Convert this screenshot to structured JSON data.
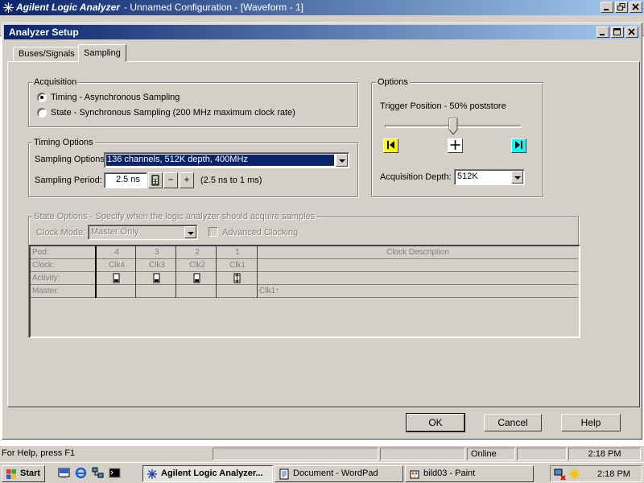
{
  "app": {
    "title_bold": "Agilent Logic Analyzer",
    "title_rest": "- Unnamed Configuration - [Waveform - 1]"
  },
  "dialog": {
    "title": "Analyzer Setup",
    "tabs": [
      {
        "label": "Buses/Signals",
        "active": false
      },
      {
        "label": "Sampling",
        "active": true
      }
    ],
    "acquisition": {
      "legend": "Acquisition",
      "options": [
        {
          "label": "Timing - Asynchronous Sampling",
          "checked": true
        },
        {
          "label": "State - Synchronous Sampling (200 MHz maximum clock rate)",
          "checked": false
        }
      ]
    },
    "timing": {
      "legend": "Timing Options",
      "sampling_options_label": "Sampling Options:",
      "sampling_options_value": "136 channels, 512K depth, 400MHz",
      "sampling_period_label": "Sampling Period:",
      "sampling_period_value": "2.5 ns",
      "sampling_period_range": "(2.5 ns to 1 ms)",
      "minus": "−",
      "plus": "+"
    },
    "options": {
      "legend": "Options",
      "trigger_label": "Trigger Position - 50% poststore",
      "trigger_percent": 50,
      "depth_label": "Acquisition Depth:",
      "depth_value": "512K"
    },
    "state": {
      "legend": "State Options - Specify when the logic analyzer should acquire samples",
      "clock_mode_label": "Clock Mode:",
      "clock_mode_value": "Master Only",
      "advanced_label": "Advanced Clocking",
      "table": {
        "row_labels": [
          "Pod:",
          "Clock:",
          "Activity:",
          "Master:"
        ],
        "pods": [
          "4",
          "3",
          "2",
          "1"
        ],
        "clocks": [
          "Clk4",
          "Clk3",
          "Clk2",
          "Clk1"
        ],
        "desc_header": "Clock Description",
        "master_desc": "Clk1↑"
      }
    },
    "buttons": {
      "ok": "OK",
      "cancel": "Cancel",
      "help": "Help"
    }
  },
  "status": {
    "help": "For Help, press F1",
    "online": "Online",
    "time": "2:18 PM"
  },
  "taskbar": {
    "start": "Start",
    "items": [
      {
        "label": "Agilent Logic Analyzer...",
        "active": true
      },
      {
        "label": "Document - WordPad",
        "active": false
      },
      {
        "label": "bild03 - Paint",
        "active": false
      }
    ],
    "clock": "2:18 PM"
  }
}
